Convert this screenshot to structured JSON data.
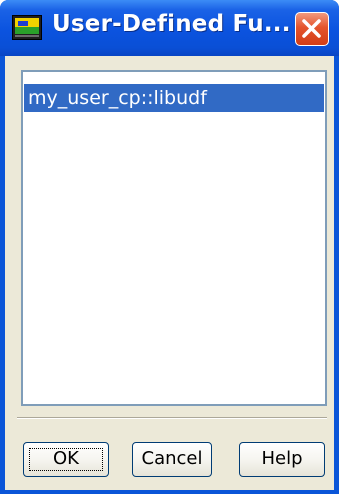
{
  "window": {
    "title": "User-Defined Fu...",
    "app_icon": "fluent-app-icon",
    "close_icon": "close-x-icon",
    "colors": {
      "titlebar": "#0a55d8",
      "close": "#e4542c",
      "client": "#ece9d8",
      "selection": "#316ac5"
    }
  },
  "list": {
    "items": [
      {
        "label": "my_user_cp::libudf",
        "selected": true
      }
    ]
  },
  "buttons": {
    "ok_label": "OK",
    "cancel_label": "Cancel",
    "help_label": "Help"
  }
}
